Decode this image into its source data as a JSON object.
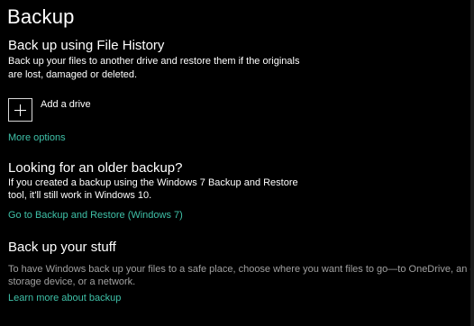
{
  "page": {
    "title": "Backup"
  },
  "file_history": {
    "heading": "Back up using File History",
    "description_line1": "Back up your files to another drive and restore them if the originals",
    "description_line2": "are lost, damaged or deleted.",
    "add_drive_label": "Add a drive",
    "more_options": "More options"
  },
  "older_backup": {
    "heading": "Looking for an older backup?",
    "description_line1": "If you created a backup using the Windows 7 Backup and Restore",
    "description_line2": "tool, it'll still work in Windows 10.",
    "link": "Go to Backup and Restore (Windows 7)"
  },
  "stuff": {
    "heading": "Back up your stuff",
    "description_line1": "To have Windows back up your files to a safe place, choose where you want files to go—to OneDrive, an extern",
    "description_line2": "storage device, or a network.",
    "link": "Learn more about backup"
  },
  "colors": {
    "background": "#000000",
    "accent_link": "#3fc1a8",
    "muted_text": "#a0a0a0"
  }
}
